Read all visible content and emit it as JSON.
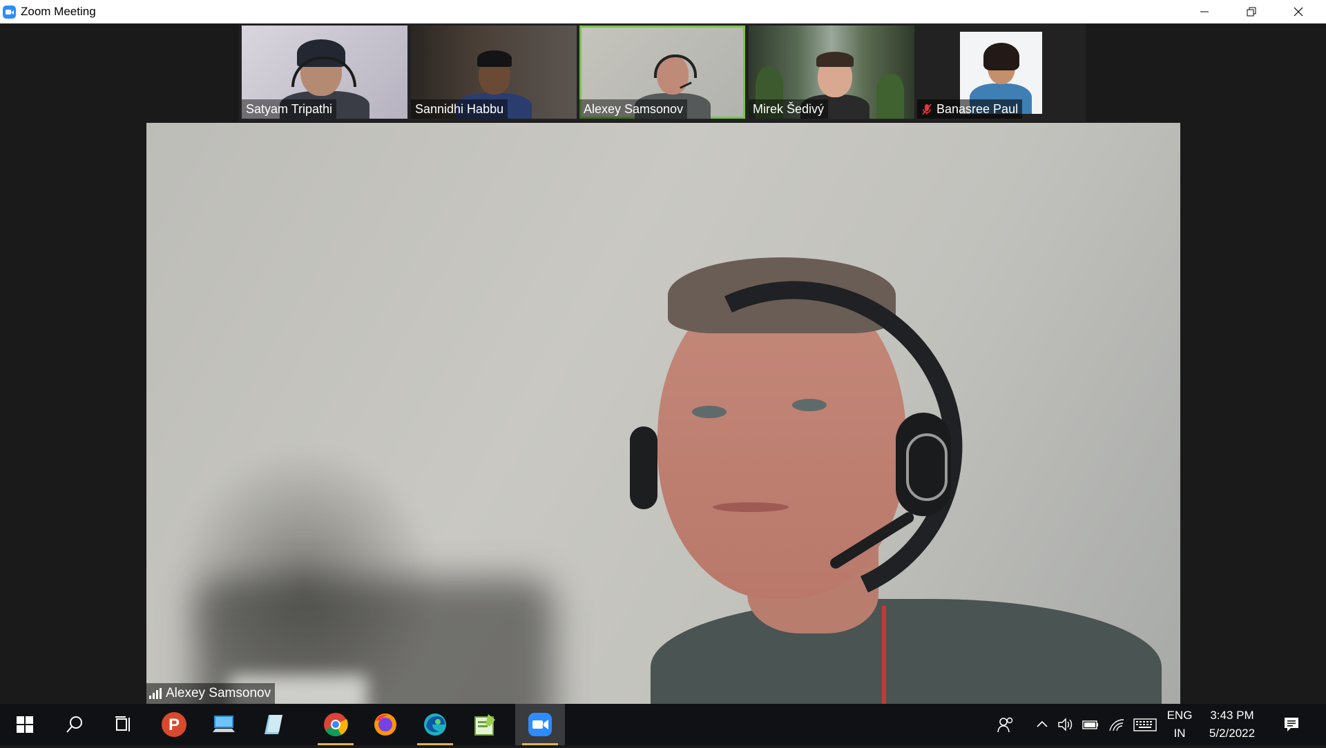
{
  "window": {
    "title": "Zoom Meeting"
  },
  "gallery": {
    "participants": [
      {
        "name": "Satyam Tripathi",
        "muted": false,
        "active": false
      },
      {
        "name": "Sannidhi Habbu",
        "muted": false,
        "active": false
      },
      {
        "name": "Alexey Samsonov",
        "muted": false,
        "active": true
      },
      {
        "name": "Mirek Šedivý",
        "muted": false,
        "active": false
      },
      {
        "name": "Banasree Paul",
        "muted": true,
        "active": false
      }
    ]
  },
  "main_video": {
    "speaker_name": "Alexey Samsonov"
  },
  "taskbar": {
    "apps": [
      "start-icon",
      "search-icon",
      "task-view-icon",
      "p-app-icon",
      "remote-desktop-icon",
      "notepad-icon",
      "chrome-icon",
      "firefox-icon",
      "edge-icon",
      "notepadpp-icon",
      "zoom-icon"
    ],
    "lang_top": "ENG",
    "lang_bottom": "IN",
    "time": "3:43 PM",
    "date": "5/2/2022"
  },
  "colors": {
    "active_border": "#79c34b",
    "zoom_blue": "#2d8cff",
    "muted_red": "#e0383a"
  }
}
